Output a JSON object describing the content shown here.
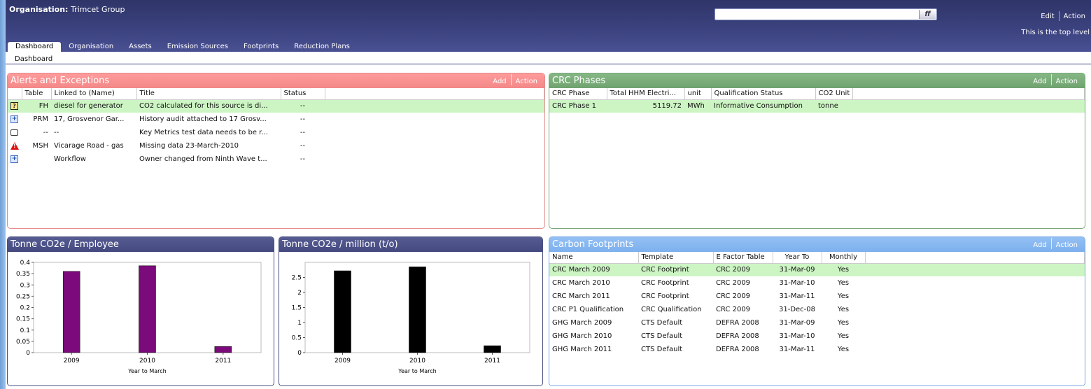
{
  "header": {
    "org_label": "Organisation:",
    "org_name": "Trimcet Group",
    "search_button": "ff",
    "search_placeholder": "",
    "edit": "Edit",
    "action": "Action",
    "top_level": "This is the top level"
  },
  "tabs": [
    "Dashboard",
    "Organisation",
    "Assets",
    "Emission Sources",
    "Footprints",
    "Reduction Plans"
  ],
  "breadcrumb": "Dashboard",
  "alerts": {
    "title": "Alerts and Exceptions",
    "add": "Add",
    "action": "Action",
    "columns": [
      "",
      "Table",
      "Linked to (Name)",
      "Title",
      "Status"
    ],
    "rows": [
      {
        "icon": "question-icon",
        "table": "FH",
        "linked": "diesel for generator",
        "title": "CO2 calculated for this source is di...",
        "status": "--"
      },
      {
        "icon": "expand-plus-icon",
        "table": "PRM",
        "linked": "17, Grosvenor Gar...",
        "title": "History audit attached to 17 Grosv...",
        "status": "--"
      },
      {
        "icon": "comment-icon",
        "table": "--",
        "linked": "--",
        "title": "Key Metrics test data needs to be r...",
        "status": "--"
      },
      {
        "icon": "warning-icon",
        "table": "MSH",
        "linked": "Vicarage Road - gas",
        "title": "Missing data 23-March-2010",
        "status": "--"
      },
      {
        "icon": "expand-plus-icon",
        "table": "",
        "linked": "Workflow",
        "title": "Owner changed from Ninth Wave t...",
        "status": "--"
      }
    ]
  },
  "crc": {
    "title": "CRC Phases",
    "add": "Add",
    "action": "Action",
    "columns": [
      "CRC Phase",
      "Total HHM Electri...",
      "unit",
      "Qualification Status",
      "CO2 Unit"
    ],
    "rows": [
      {
        "phase": "CRC Phase 1",
        "total": "5119.72",
        "unit": "MWh",
        "status": "Informative Consumption",
        "co2unit": "tonne"
      }
    ]
  },
  "footprints": {
    "title": "Carbon Footprints",
    "add": "Add",
    "action": "Action",
    "columns": [
      "Name",
      "Template",
      "E Factor Table",
      "Year To",
      "Monthly"
    ],
    "rows": [
      {
        "name": "CRC March 2009",
        "template": "CRC Footprint",
        "efactor": "CRC 2009",
        "yearto": "31-Mar-09",
        "monthly": "Yes"
      },
      {
        "name": "CRC March 2010",
        "template": "CRC Footprint",
        "efactor": "CRC 2009",
        "yearto": "31-Mar-10",
        "monthly": "Yes"
      },
      {
        "name": "CRC March 2011",
        "template": "CRC Footprint",
        "efactor": "CRC 2009",
        "yearto": "31-Mar-11",
        "monthly": "Yes"
      },
      {
        "name": "CRC P1 Qualification",
        "template": "CRC Qualification",
        "efactor": "CRC 2009",
        "yearto": "31-Dec-08",
        "monthly": "Yes"
      },
      {
        "name": "GHG March 2009",
        "template": "CTS Default",
        "efactor": "DEFRA 2008",
        "yearto": "31-Mar-09",
        "monthly": "Yes"
      },
      {
        "name": "GHG March 2010",
        "template": "CTS Default",
        "efactor": "DEFRA 2008",
        "yearto": "31-Mar-10",
        "monthly": "Yes"
      },
      {
        "name": "GHG March 2011",
        "template": "CTS Default",
        "efactor": "DEFRA 2008",
        "yearto": "31-Mar-11",
        "monthly": "Yes"
      }
    ]
  },
  "chart_data": [
    {
      "type": "bar",
      "title": "Tonne CO2e / Employee",
      "categories": [
        "2009",
        "2010",
        "2011"
      ],
      "values": [
        0.36,
        0.385,
        0.027
      ],
      "xlabel": "Year to March",
      "ylabel": "",
      "ylim": [
        0,
        0.4
      ],
      "yticks": [
        "0",
        "0.05",
        "0.1",
        "0.15",
        "0.2",
        "0.25",
        "0.3",
        "0.35",
        "0.4"
      ],
      "ytick_values": [
        0,
        0.05,
        0.1,
        0.15,
        0.2,
        0.25,
        0.3,
        0.35,
        0.4
      ],
      "color": "#7b0a7b",
      "grid": false
    },
    {
      "type": "bar",
      "title": "Tonne CO2e / million (t/o)",
      "categories": [
        "2009",
        "2010",
        "2011"
      ],
      "values": [
        2.72,
        2.85,
        0.23
      ],
      "xlabel": "Year to March",
      "ylabel": "",
      "ylim": [
        0,
        3
      ],
      "yticks": [
        "0",
        "0.5",
        "1",
        "1.5",
        "2",
        "2.5"
      ],
      "ytick_values": [
        0,
        0.5,
        1,
        1.5,
        2,
        2.5
      ],
      "color": "#000000",
      "grid": false
    }
  ]
}
